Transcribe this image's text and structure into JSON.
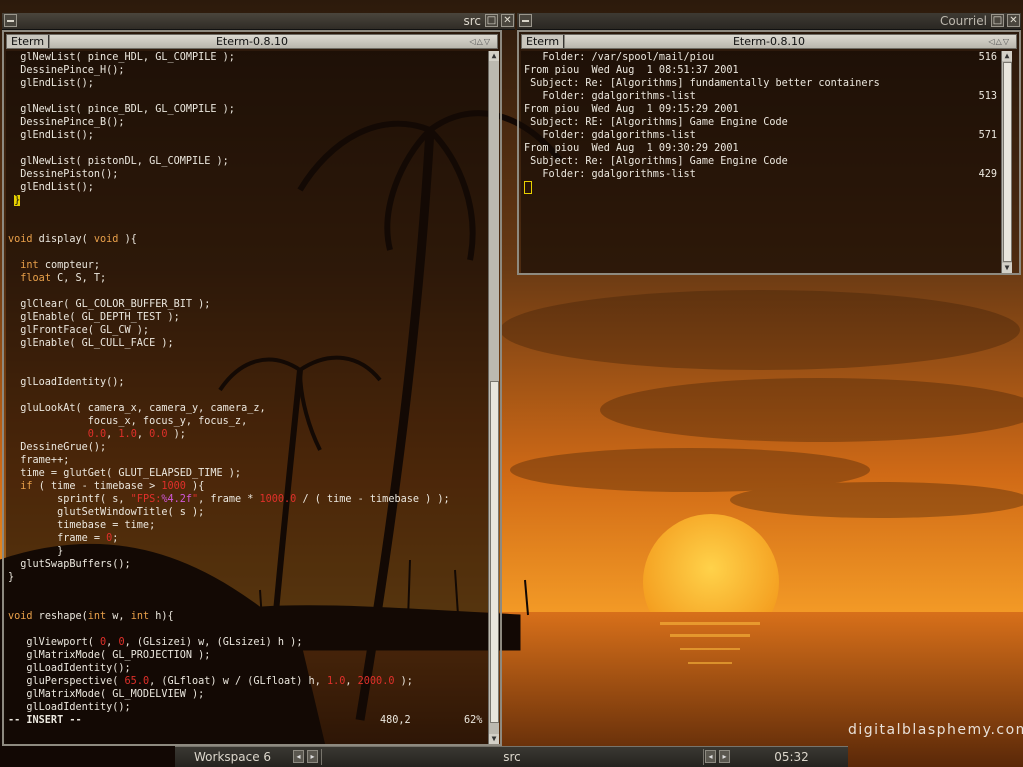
{
  "wallpaper": {
    "watermark": "digitalblasphemy.com"
  },
  "win_left": {
    "title": "src",
    "tab_name": "Eterm",
    "tab_title": "Eterm-0.8.10",
    "arrows": "◁△▽",
    "lines": [
      "  glNewList( pince_HDL, GL_COMPILE );",
      "  DessinePince_H();",
      "  glEndList();",
      "",
      "  glNewList( pince_BDL, GL_COMPILE );",
      "  DessinePince_B();",
      "  glEndList();",
      "",
      "  glNewList( pistonDL, GL_COMPILE );",
      "  DessinePiston();",
      "  glEndList();",
      " }",
      "",
      "",
      "void display( void ){",
      "",
      "  int compteur;",
      "  float C, S, T;",
      "",
      "  glClear( GL_COLOR_BUFFER_BIT );",
      "  glEnable( GL_DEPTH_TEST );",
      "  glFrontFace( GL_CW );",
      "  glEnable( GL_CULL_FACE );",
      "",
      "",
      "  glLoadIdentity();",
      "",
      "  gluLookAt( camera_x, camera_y, camera_z,",
      "             focus_x, focus_y, focus_z,",
      "             0.0, 1.0, 0.0 );",
      "  DessineGrue();",
      "  frame++;",
      "  time = glutGet( GLUT_ELAPSED_TIME );",
      "  if ( time - timebase > 1000 ){",
      "        sprintf( s, \"FPS:%4.2f\", frame * 1000.0 / ( time - timebase ) );",
      "        glutSetWindowTitle( s );",
      "        timebase = time;",
      "        frame = 0;",
      "        }",
      "  glutSwapBuffers();",
      "}",
      "",
      "",
      "void reshape(int w, int h){",
      "",
      "   glViewport( 0, 0, (GLsizei) w, (GLsizei) h );",
      "   glMatrixMode( GL_PROJECTION );",
      "   glLoadIdentity();",
      "   gluPerspective( 65.0, (GLfloat) w / (GLfloat) h, 1.0, 2000.0 );",
      "   glMatrixMode( GL_MODELVIEW );",
      "   glLoadIdentity();"
    ],
    "status": {
      "mode": "-- INSERT --",
      "position": "480,2",
      "percent": "62%"
    }
  },
  "win_right": {
    "title": "Courriel",
    "tab_name": "Eterm",
    "tab_title": "Eterm-0.8.10",
    "arrows": "◁△▽",
    "lines": [
      {
        "text": "   Folder: /var/spool/mail/piou",
        "count": "516"
      },
      {
        "text": "From piou  Wed Aug  1 08:51:37 2001",
        "count": ""
      },
      {
        "text": " Subject: Re: [Algorithms] fundamentally better containers",
        "count": ""
      },
      {
        "text": "   Folder: gdalgorithms-list",
        "count": "513"
      },
      {
        "text": "From piou  Wed Aug  1 09:15:29 2001",
        "count": ""
      },
      {
        "text": " Subject: RE: [Algorithms] Game Engine Code",
        "count": ""
      },
      {
        "text": "   Folder: gdalgorithms-list",
        "count": "571"
      },
      {
        "text": "From piou  Wed Aug  1 09:30:29 2001",
        "count": ""
      },
      {
        "text": " Subject: Re: [Algorithms] Game Engine Code",
        "count": ""
      },
      {
        "text": "   Folder: gdalgorithms-list",
        "count": "429"
      }
    ]
  },
  "taskbar": {
    "workspace": "Workspace 6",
    "active_window": "src",
    "clock": "05:32",
    "arrow_left": "◂",
    "arrow_right": "▸"
  }
}
